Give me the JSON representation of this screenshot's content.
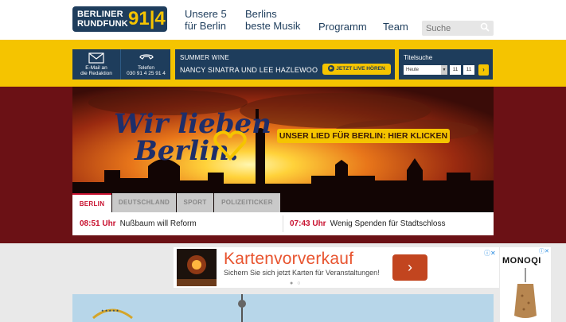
{
  "header": {
    "logo": {
      "line1": "BERLINER",
      "line2": "RUNDFUNK",
      "number": "91|4"
    },
    "nav": [
      {
        "line1": "Unsere 5",
        "line2": "für Berlin"
      },
      {
        "line1": "Berlins",
        "line2": "beste Musik"
      },
      {
        "line1": "Programm",
        "line2": ""
      },
      {
        "line1": "Team",
        "line2": ""
      }
    ],
    "search_placeholder": "Suche"
  },
  "contact": {
    "email_label_1": "E-Mail an",
    "email_label_2": "die Redaktion",
    "phone_label": "Telefon",
    "phone_number": "030 91 4 25 91 4"
  },
  "now_playing": {
    "title": "SUMMER WINE",
    "artist": "NANCY SINATRA UND LEE HAZLEWOO",
    "live_button": "JETZT LIVE HÖREN"
  },
  "titelsuche": {
    "label": "Titelsuche",
    "day": "Heute",
    "hour": "11",
    "minute": "11"
  },
  "hero": {
    "logo_text_1": "Wir lieben",
    "logo_text_2": "Berlin.",
    "cta": "UNSER LIED FÜR BERLIN: HIER KLICKEN"
  },
  "tabs": [
    "BERLIN",
    "DEUTSCHLAND",
    "SPORT",
    "POLIZEITICKER"
  ],
  "news": [
    {
      "time": "08:51 Uhr",
      "text": "Nußbaum will Reform"
    },
    {
      "time": "07:43 Uhr",
      "text": "Wenig Spenden für Stadtschloss"
    }
  ],
  "ad": {
    "title": "Kartenvorverkauf",
    "subtitle": "Sichern Sie sich jetzt Karten für Veranstaltungen!",
    "button_symbol": "›"
  },
  "ad2": {
    "brand": "MONOQI"
  },
  "colors": {
    "navy": "#1e3d5c",
    "yellow": "#f5c400",
    "maroon": "#6b1115",
    "red": "#c8102e"
  }
}
